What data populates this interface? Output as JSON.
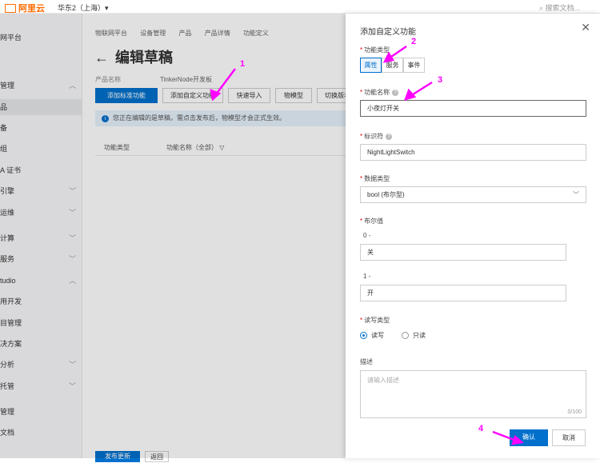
{
  "topbar": {
    "logo_text": "阿里云",
    "region": "华东2（上海）▾",
    "search_placeholder": "搜索文档..."
  },
  "sidebar": {
    "items": [
      {
        "label": "网平台"
      },
      {
        "label": "管理"
      },
      {
        "label": "品"
      },
      {
        "label": "备"
      },
      {
        "label": "组"
      },
      {
        "label": "A 证书"
      },
      {
        "label": "引擎"
      },
      {
        "label": "运维"
      },
      {
        "label": "计算"
      },
      {
        "label": "服务"
      },
      {
        "label": "tudio"
      },
      {
        "label": "用开发"
      },
      {
        "label": "目管理"
      },
      {
        "label": "决方案"
      },
      {
        "label": "分析"
      },
      {
        "label": "托管"
      },
      {
        "label": "管理"
      },
      {
        "label": "文档"
      }
    ]
  },
  "breadcrumb": [
    "物联网平台",
    "设备管理",
    "产品",
    "产品详情",
    "功能定义"
  ],
  "page": {
    "title": "编辑草稿",
    "product_name_label": "产品名称",
    "product_name_value": "TinkerNode开发板"
  },
  "toolbar": {
    "btn1": "添加标准功能",
    "btn2": "添加自定义功能",
    "btn3": "快速导入",
    "btn4": "物模型",
    "btn5": "切换版本"
  },
  "notice": "您正在编辑的是草稿，需点击发布后，物模型才会正式生效。",
  "table": {
    "col1": "功能类型",
    "col2": "功能名称（全部）"
  },
  "footer": {
    "publish": "发布更新",
    "back": "返回"
  },
  "dialog": {
    "title": "添加自定义功能",
    "type_label": "功能类型",
    "type_options": [
      "属性",
      "服务",
      "事件"
    ],
    "name_label": "功能名称",
    "name_value": "小夜灯开关",
    "id_label": "标识符",
    "id_value": "NightLightSwitch",
    "dtype_label": "数据类型",
    "dtype_value": "bool (布尔型)",
    "bool_label": "布尔值",
    "bool_0_label": "0 -",
    "bool_0_value": "关",
    "bool_1_label": "1 -",
    "bool_1_value": "开",
    "rw_label": "读写类型",
    "rw_options": [
      "读写",
      "只读"
    ],
    "desc_label": "描述",
    "desc_placeholder": "请输入描述",
    "desc_counter": "0/100",
    "ok": "确认",
    "cancel": "取消"
  },
  "annotations": {
    "a1": "1",
    "a2": "2",
    "a3": "3",
    "a4": "4"
  },
  "colors": {
    "accent": "#0070cc",
    "brand": "#ff6a00",
    "annotation": "#ff00ff"
  }
}
